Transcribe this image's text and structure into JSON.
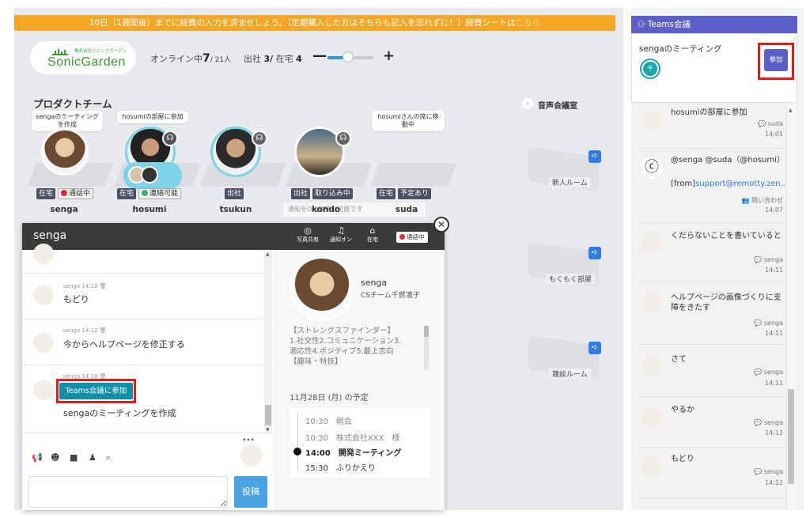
{
  "banner": {
    "text": "10日（1週間後）までに経費の入力を済ませしょう。（定期購入した方はそちらも記入を忘れずに！）経費シートは",
    "link": "こちら"
  },
  "logo": {
    "name": "SonicGarden",
    "sub": "株式会社ソニックガーデン"
  },
  "stats": {
    "online_label": "オンライン中",
    "online_count": "7",
    "online_total": "/ 21人",
    "office_label": "出社",
    "office_count": "3/",
    "home_label": "在宅",
    "home_count": "4",
    "zoom_minus": "—",
    "zoom_plus": "+",
    "zoom_level": 0.45
  },
  "team": {
    "title": "プロダクトチーム",
    "members": [
      {
        "name": "senga",
        "bubble": "sengaのミーティングを作成",
        "tags": [
          "在宅",
          "通話中"
        ]
      },
      {
        "name": "hosumi",
        "bubble": "hosumiの部屋に参加",
        "tags": [
          "在宅",
          "連絡可能"
        ]
      },
      {
        "name": "tsukun",
        "bubble": "",
        "tags": [
          "出社"
        ]
      },
      {
        "name": "kondo",
        "bubble": "",
        "tags": [
          "出社",
          "取り込み中"
        ]
      },
      {
        "name": "suda",
        "bubble": "hosumiさんの席に移動中",
        "tags": [
          "在宅",
          "予定あり"
        ]
      }
    ],
    "notice": "通知をON/OFFが可能です"
  },
  "voice": {
    "title": "音声会議室",
    "rooms": [
      {
        "label": "新人ルーム"
      },
      {
        "label": "もくもく部屋"
      },
      {
        "label": "雑談ルーム"
      }
    ]
  },
  "chat": {
    "title": "senga",
    "header_icons": [
      {
        "glyph": "◎",
        "label": "写真共有"
      },
      {
        "glyph": "♫",
        "label": "通知オン"
      },
      {
        "glyph": "⌂",
        "label": "在宅"
      }
    ],
    "status": "通話中",
    "close": "✕",
    "messages": [
      {
        "meta": "senga 14:12 🗑",
        "text": "もどり"
      },
      {
        "meta": "senga 14:12 🗑",
        "text": "今からヘルプページを修正する"
      },
      {
        "meta": "senga 14:18 🗑",
        "text": "sengaのミーティングを作成",
        "button": "Teams会議に参加"
      }
    ],
    "more": "•••",
    "post_button": "投稿"
  },
  "profile": {
    "name": "senga",
    "role": "CSチーム千賀凛子",
    "bio_lines": [
      "【ストレングスファインダー】",
      "1.社交性2.コミュニケーション3.",
      "適応性4.ポジティブ5.最上志向",
      "【趣味・特技】"
    ],
    "schedule_title": "11月28日 (月) の予定",
    "schedule": [
      {
        "time": "10:30",
        "title": "朝会",
        "current": false
      },
      {
        "time": "10:30",
        "title": "株式会社XXX　様",
        "current": false
      },
      {
        "time": "14:00",
        "title": "開発ミーティング",
        "current": true
      },
      {
        "time": "15:30",
        "title": "ふりかえり",
        "current": false
      }
    ]
  },
  "sidebar": {
    "header": "Teams会議",
    "meeting_title": "sengaのミーティング",
    "join_label": "参加",
    "avatar_initial": "千",
    "feed": [
      {
        "text": "hosumiの部屋に参加",
        "who": "suda",
        "when": "14:01"
      },
      {
        "text": "@senga @suda（@hosumi）",
        "from_prefix": "[from]",
        "from_link": "support@remotty.zen...",
        "who": "問い合わせ",
        "when": "14:07"
      },
      {
        "text": "くだらないことを書いていると",
        "who": "senga",
        "when": "14:11"
      },
      {
        "text": "ヘルプページの画像づくりに支障をきたす",
        "who": "senga",
        "when": "14:11"
      },
      {
        "text": "さて",
        "who": "senga",
        "when": "14:11"
      },
      {
        "text": "やるか",
        "who": "senga",
        "when": "14:12"
      },
      {
        "text": "もどり",
        "who": "senga",
        "when": "14:12"
      }
    ]
  },
  "colors": {
    "banner": "#f5a623",
    "teams": "#5b5fc7",
    "highlight": "#e41b1b",
    "join_button": "#0f8fa8",
    "busy": "#e0263a",
    "available": "#3cb371"
  }
}
